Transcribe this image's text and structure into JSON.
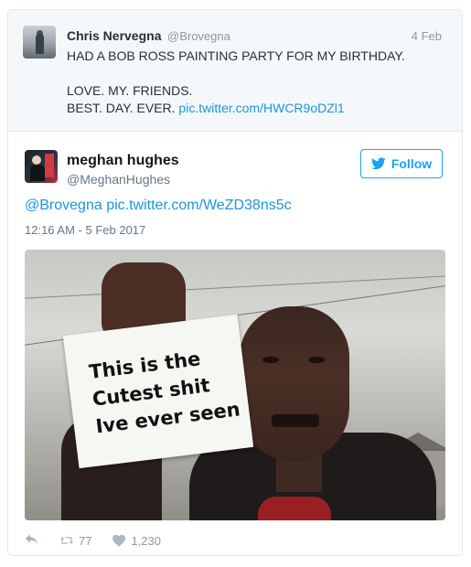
{
  "quoted_tweet": {
    "name": "Chris Nervegna",
    "handle": "@Brovegna",
    "date": "4 Feb",
    "text_line1": "HAD A BOB ROSS PAINTING PARTY FOR MY BIRTHDAY.",
    "text_line2": "LOVE. MY. FRIENDS.",
    "text_line3": "BEST. DAY. EVER.",
    "link": "pic.twitter.com/HWCR9oDZl1"
  },
  "tweet": {
    "name": "meghan hughes",
    "handle": "@MeghanHughes",
    "follow_label": "Follow",
    "text_mention": "@Brovegna",
    "text_link": "pic.twitter.com/WeZD38ns5c",
    "timestamp": "12:16 AM - 5 Feb 2017",
    "image_sign_text": "This is the\nCutest shit\nIve ever seen",
    "retweets": "77",
    "likes": "1,230"
  },
  "icons": [
    "reply-icon",
    "retweet-icon",
    "heart-icon",
    "twitter-bird-icon"
  ],
  "colors": {
    "link": "#1b95e0",
    "follow": "#1da1f2",
    "muted": "#8899a6"
  }
}
